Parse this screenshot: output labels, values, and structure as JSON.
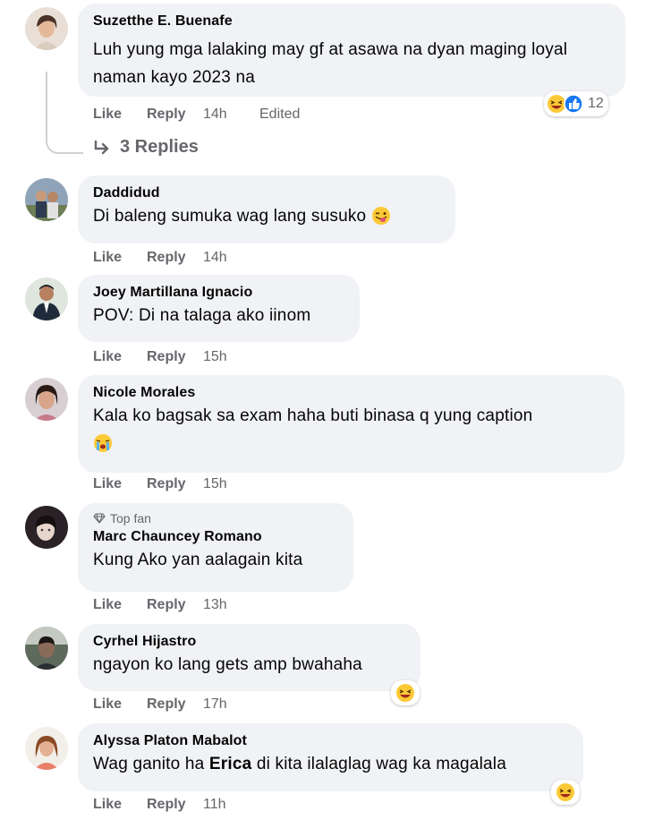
{
  "comments": [
    {
      "name": "Suzetthe E. Buenafe",
      "text": "Luh yung mga lalaking may gf at asawa na dyan maging loyal naman kayo 2023 na",
      "like": "Like",
      "reply": "Reply",
      "time": "14h",
      "edited": "Edited",
      "reaction_count": "12",
      "replies_label": "3 Replies"
    },
    {
      "name": "Daddidud",
      "text": "Di baleng sumuka wag lang susuko",
      "like": "Like",
      "reply": "Reply",
      "time": "14h"
    },
    {
      "name": "Joey Martillana Ignacio",
      "text": "POV: Di na talaga ako iinom",
      "like": "Like",
      "reply": "Reply",
      "time": "15h"
    },
    {
      "name": "Nicole Morales",
      "text": "Kala ko bagsak sa exam haha buti binasa q yung caption",
      "like": "Like",
      "reply": "Reply",
      "time": "15h"
    },
    {
      "name": "Marc Chauncey Romano",
      "badge": "Top fan",
      "text": "Kung Ako yan aalagain kita",
      "like": "Like",
      "reply": "Reply",
      "time": "13h"
    },
    {
      "name": "Cyrhel Hijastro",
      "text": "ngayon ko lang gets amp bwahaha",
      "like": "Like",
      "reply": "Reply",
      "time": "17h"
    },
    {
      "name": "Alyssa Platon Mabalot",
      "text_before": "Wag ganito ha ",
      "text_bold": "Erica",
      "text_after": " di kita ilalaglag wag ka magalala",
      "like": "Like",
      "reply": "Reply",
      "time": "11h"
    }
  ],
  "icons": {
    "laugh": "laughing-emoji-icon",
    "like_react": "like-reaction-icon",
    "cry": "crying-emoji-icon",
    "wink": "tongue-wink-emoji-icon",
    "diamond": "diamond-icon",
    "reply_arrow": "reply-arrow-icon"
  },
  "colors": {
    "bubble": "#f0f2f5",
    "meta": "#65676b",
    "text": "#050505",
    "like_blue": "#1877f2",
    "emoji_yellow": "#fcc936"
  }
}
